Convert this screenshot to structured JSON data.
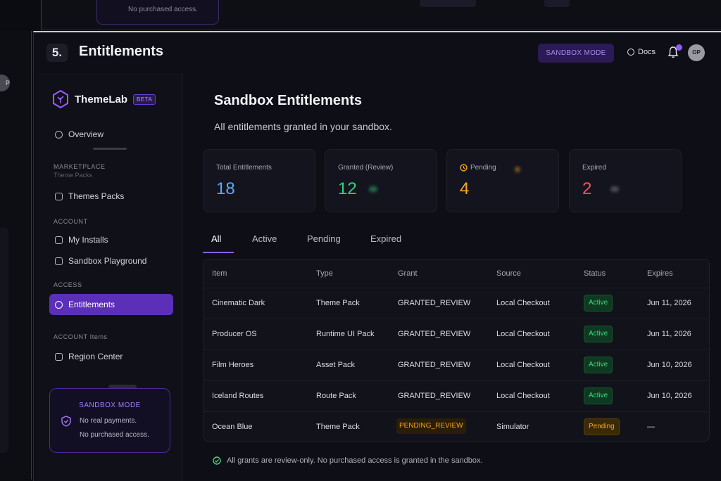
{
  "background": {
    "top_card_text": "No purchased access.",
    "left_avatar": "P"
  },
  "header": {
    "step": "5.",
    "title": "Entitlements",
    "sandbox_pill": "SANDBOX MODE",
    "docs_label": "Docs",
    "avatar_initials": "OP"
  },
  "sidebar": {
    "brand": "ThemeLab",
    "beta": "BETA",
    "overview": "Overview",
    "section_marketplace": "MARKETPLACE",
    "marketplace_ghost": "Theme Packs",
    "theme_packs": "Themes Packs",
    "section_account": "ACCOUNT",
    "my_installs": "My Installs",
    "sandbox_playground": "Sandbox Playground",
    "section_access": "ACCESS",
    "entitlements": "Entitlements",
    "section_account_items": "ACCOUNT Items",
    "region_center": "Region Center",
    "card": {
      "title": "SANDBOX MODE",
      "line1": "No real payments.",
      "line2": "No purchased access."
    }
  },
  "main": {
    "heading": "Sandbox Entitlements",
    "subtitle": "All entitlements granted in your sandbox.",
    "stats": [
      {
        "label": "Total Entitlements",
        "value": "18",
        "color": "#5aa9ff"
      },
      {
        "label": "Granted (Review)",
        "value": "12",
        "color": "#35d07f"
      },
      {
        "label": "Pending",
        "value": "4",
        "color": "#f5a524"
      },
      {
        "label": "Expired",
        "value": "2",
        "color": "#ff4d5e"
      }
    ],
    "tabs": [
      "All",
      "Active",
      "Pending",
      "Expired"
    ],
    "table": {
      "columns": [
        "Item",
        "Type",
        "Grant",
        "Source",
        "Status",
        "Expires"
      ],
      "rows": [
        {
          "item": "Cinematic Dark",
          "type": "Theme Pack",
          "grant": "GRANTED_REVIEW",
          "source": "Local Checkout",
          "status": "Active",
          "expires": "Jun 11, 2026"
        },
        {
          "item": "Producer OS",
          "type": "Runtime UI Pack",
          "grant": "GRANTED_REVIEW",
          "source": "Local Checkout",
          "status": "Active",
          "expires": "Jun 11, 2026"
        },
        {
          "item": "Film Heroes",
          "type": "Asset Pack",
          "grant": "GRANTED_REVIEW",
          "source": "Local Checkout",
          "status": "Active",
          "expires": "Jun 10, 2026"
        },
        {
          "item": "Iceland Routes",
          "type": "Route Pack",
          "grant": "GRANTED_REVIEW",
          "source": "Local Checkout",
          "status": "Active",
          "expires": "Jun 10, 2026"
        },
        {
          "item": "Ocean Blue",
          "type": "Theme Pack",
          "grant": "PENDING_REVIEW",
          "source": "Simulator",
          "status": "Pending",
          "expires": "—"
        }
      ]
    },
    "footer_note": "All grants are review-only. No purchased access is granted in the sandbox."
  }
}
